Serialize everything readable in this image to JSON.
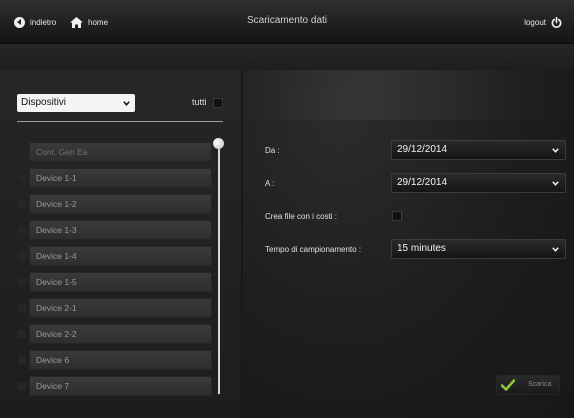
{
  "header": {
    "back_label": "indietro",
    "home_label": "home",
    "title": "Scaricamento dati",
    "logout_label": "logout"
  },
  "sidebar": {
    "filter_select_value": "Dispositivi",
    "select_all_label": "tutti",
    "select_all_checked": false,
    "devices": [
      {
        "label": "Cont. Gen Ea",
        "checked": false
      },
      {
        "label": "Device 1-1",
        "checked": false
      },
      {
        "label": "Device 1-2",
        "checked": false
      },
      {
        "label": "Device 1-3",
        "checked": false
      },
      {
        "label": "Device 1-4",
        "checked": false
      },
      {
        "label": "Device 1-5",
        "checked": false
      },
      {
        "label": "Device 2-1",
        "checked": false
      },
      {
        "label": "Device 2-2",
        "checked": false
      },
      {
        "label": "Device 6",
        "checked": false
      },
      {
        "label": "Device 7",
        "checked": false
      }
    ]
  },
  "form": {
    "from_label": "Da :",
    "from_value": "29/12/2014",
    "to_label": "A :",
    "to_value": "29/12/2014",
    "costs_label": "Crea file con i costi :",
    "costs_checked": false,
    "sampling_label": "Tempo di campionamento :",
    "sampling_value": "15 minutes"
  },
  "actions": {
    "download_label": "Scarica"
  },
  "colors": {
    "accent_check": "#8cc63f",
    "background": "#1c1c1c"
  }
}
